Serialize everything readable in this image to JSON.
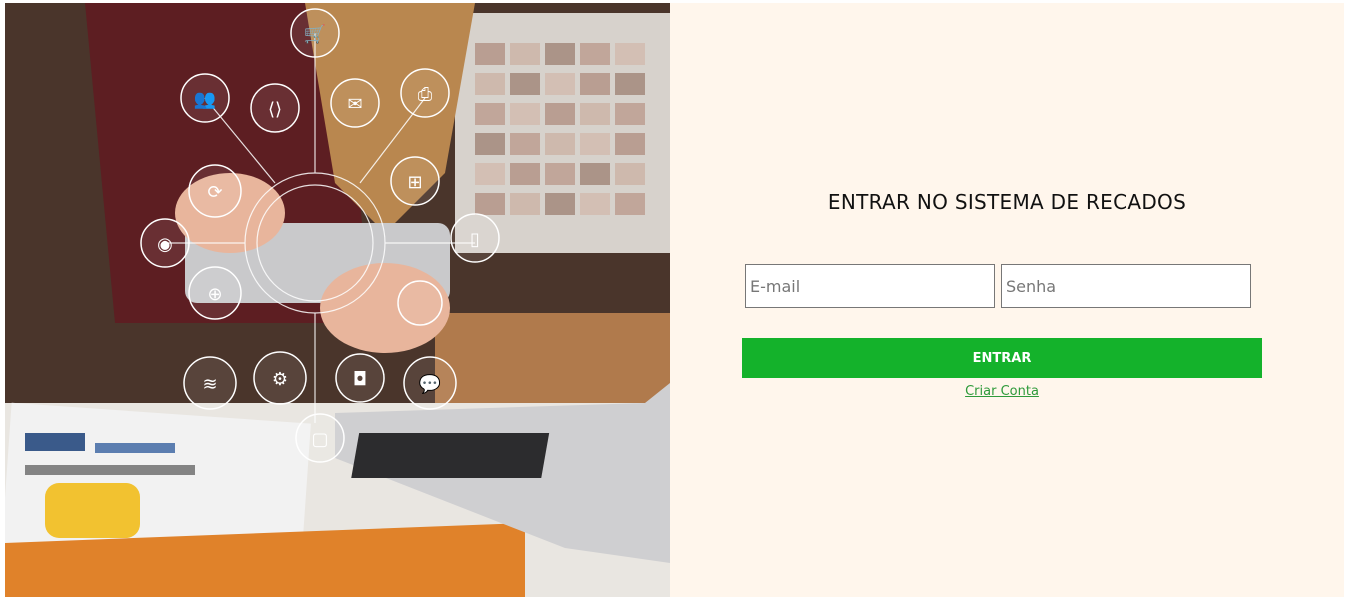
{
  "hero": {
    "icons": [
      "cart-icon",
      "users-icon",
      "share-icon",
      "mail-icon",
      "printer-icon",
      "refresh-icon",
      "network-icon",
      "smartphone-icon",
      "signal-icon",
      "globe-icon",
      "wifi-icon",
      "gear-icon",
      "camera-icon",
      "chat-icon",
      "mouse-icon"
    ]
  },
  "login": {
    "title": "ENTRAR NO SISTEMA DE RECADOS",
    "email_placeholder": "E-mail",
    "password_placeholder": "Senha",
    "submit_label": "ENTRAR",
    "create_account_label": "Criar Conta"
  },
  "colors": {
    "panel_bg": "#fff6ec",
    "button_bg": "#14b22b",
    "link": "#2e9a3a"
  }
}
